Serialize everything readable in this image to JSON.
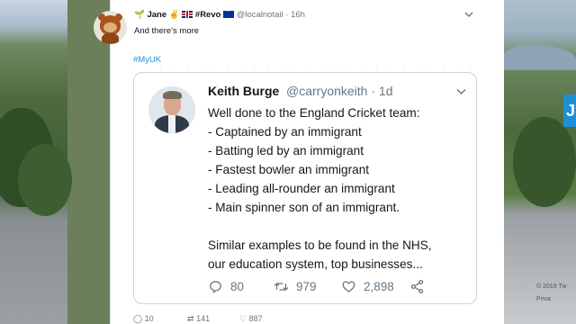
{
  "tweet": {
    "sprout_emoji": "🌱",
    "author_name": "Jane",
    "hand_emoji": "✌",
    "tag_revo": "#Revo",
    "handle": "@localnotail",
    "separator": "·",
    "time": "16h",
    "text": "And there's more",
    "hashtag": "#MyUK",
    "actions": {
      "replies": "10",
      "retweets": "141",
      "likes": "887"
    }
  },
  "quoted_tweet": {
    "author_name": "Keith Burge",
    "handle": "@carryonkeith",
    "separator": "·",
    "time": "1d",
    "lines": [
      "Well done to the England Cricket team:",
      "- Captained by an immigrant",
      "- Batting led by an immigrant",
      "- Fastest bowler an immigrant",
      "- Leading all-rounder an immigrant",
      "- Main spinner son of an immigrant.",
      "",
      "Similar examples to be found in the NHS,",
      "our education system, top businesses..."
    ],
    "actions": {
      "replies": "80",
      "retweets": "979",
      "likes": "2,898"
    }
  },
  "sidebar": {
    "button_letter": "J",
    "footer_line1": "© 2019 Tw",
    "footer_line2": "Priva"
  },
  "colors": {
    "link_blue": "#1b95e0",
    "muted_gray": "#657786",
    "text_dark": "#14171a",
    "border": "#ccd6dd"
  }
}
